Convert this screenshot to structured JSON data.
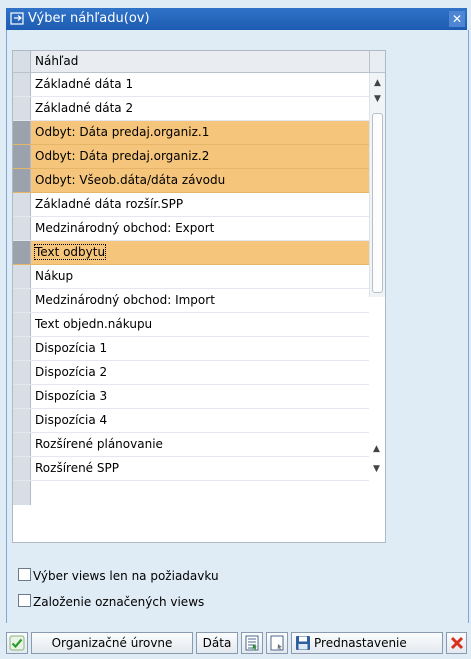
{
  "window": {
    "title": "Výber náhľadu(ov)",
    "close_icon": "close-icon"
  },
  "table": {
    "column_header": "Náhľad",
    "rows": [
      {
        "label": "Základné dáta 1",
        "selected": false
      },
      {
        "label": "Základné dáta 2",
        "selected": false
      },
      {
        "label": "Odbyt: Dáta predaj.organiz.1",
        "selected": true
      },
      {
        "label": "Odbyt: Dáta predaj.organiz.2",
        "selected": true
      },
      {
        "label": "Odbyt: Všeob.dáta/dáta závodu",
        "selected": true
      },
      {
        "label": "Základné dáta rozšír.SPP",
        "selected": false
      },
      {
        "label": "Medzinárodný obchod: Export",
        "selected": false
      },
      {
        "label": "Text odbytu",
        "selected": true
      },
      {
        "label": "Nákup",
        "selected": false
      },
      {
        "label": "Medzinárodný obchod: Import",
        "selected": false
      },
      {
        "label": "Text objedn.nákupu",
        "selected": false
      },
      {
        "label": "Dispozícia 1",
        "selected": false
      },
      {
        "label": "Dispozícia 2",
        "selected": false
      },
      {
        "label": "Dispozícia 3",
        "selected": false
      },
      {
        "label": "Dispozícia 4",
        "selected": false
      },
      {
        "label": "Rozšírené plánovanie",
        "selected": false
      },
      {
        "label": "Rozšírené SPP",
        "selected": false
      }
    ]
  },
  "options": {
    "views_on_request": "Výber views len na požiadavku",
    "create_selected_views": "Založenie označených views"
  },
  "toolbar": {
    "org_levels": "Organizačné úrovne",
    "data": "Dáta",
    "default": "Prednastavenie"
  },
  "colors": {
    "selection": "#f4c57b",
    "title_bar": "#2f73c8",
    "background": "#dfebf5",
    "confirm": "#2e9a2e",
    "cancel": "#d9301f"
  }
}
